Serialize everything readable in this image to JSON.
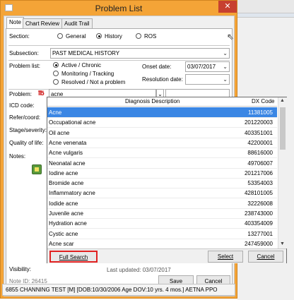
{
  "window": {
    "title": "Problem List",
    "close_glyph": "✕"
  },
  "tabs": [
    {
      "label": "Note",
      "active": true
    },
    {
      "label": "Chart Review",
      "active": false
    },
    {
      "label": "Audit Trail",
      "active": false
    }
  ],
  "section": {
    "label": "Section:",
    "options": [
      {
        "label": "General",
        "selected": false
      },
      {
        "label": "History",
        "selected": true
      },
      {
        "label": "ROS",
        "selected": false
      }
    ]
  },
  "subsection": {
    "label": "Subsection:",
    "value": "PAST MEDICAL HISTORY"
  },
  "problem_list": {
    "label": "Problem list:",
    "options": [
      {
        "label": "Active / Chronic",
        "selected": true
      },
      {
        "label": "Monitoring / Tracking",
        "selected": false
      },
      {
        "label": "Resolved / Not a problem",
        "selected": false
      }
    ]
  },
  "onset_date": {
    "label": "Onset date:",
    "value": "03/07/2017"
  },
  "resolution_date": {
    "label": "Resolution date:",
    "value": ""
  },
  "problem": {
    "label": "Problem:",
    "value": "acne",
    "icon": "red-flag-icon"
  },
  "left_labels": {
    "icd_code": "ICD code:",
    "refer_coord": "Refer/coord:",
    "stage_severity": "Stage/severity:",
    "quality_of_life": "Quality of life:",
    "notes": "Notes:",
    "visibility": "Visibility:"
  },
  "popup": {
    "col_description": "Diagnosis Description",
    "col_code": "DX Code",
    "rows": [
      {
        "description": "Acne",
        "code": "11381005",
        "selected": true
      },
      {
        "description": "Occupational acne",
        "code": "201220003",
        "selected": false
      },
      {
        "description": "Oil acne",
        "code": "403351001",
        "selected": false
      },
      {
        "description": "Acne venenata",
        "code": "42200001",
        "selected": false
      },
      {
        "description": "Acne vulgaris",
        "code": "88616000",
        "selected": false
      },
      {
        "description": "Neonatal acne",
        "code": "49706007",
        "selected": false
      },
      {
        "description": "Iodine acne",
        "code": "201217006",
        "selected": false
      },
      {
        "description": "Bromide acne",
        "code": "53354003",
        "selected": false
      },
      {
        "description": "Inflammatory acne",
        "code": "428101005",
        "selected": false
      },
      {
        "description": "Iodide acne",
        "code": "32226008",
        "selected": false
      },
      {
        "description": "Juvenile acne",
        "code": "238743000",
        "selected": false
      },
      {
        "description": "Hydration acne",
        "code": "403354009",
        "selected": false
      },
      {
        "description": "Cystic acne",
        "code": "13277001",
        "selected": false
      },
      {
        "description": "Acne scar",
        "code": "247459000",
        "selected": false
      }
    ],
    "full_search_label": "Full Search",
    "select_label": "Select",
    "cancel_label": "Cancel",
    "highlight_color": "#3a86e4",
    "full_search_border_color": "#e02020"
  },
  "footer": {
    "note_id": "Note ID: 26415",
    "last_updated_partial": "Last updated: 03/07/2017",
    "save_label": "Save",
    "cancel_label": "Cancel"
  },
  "status_bar": "6855 CHANNING TEST [M] [DOB:10/30/2006 Age DOV:10 yrs. 4 mos.] AETNA PPO"
}
